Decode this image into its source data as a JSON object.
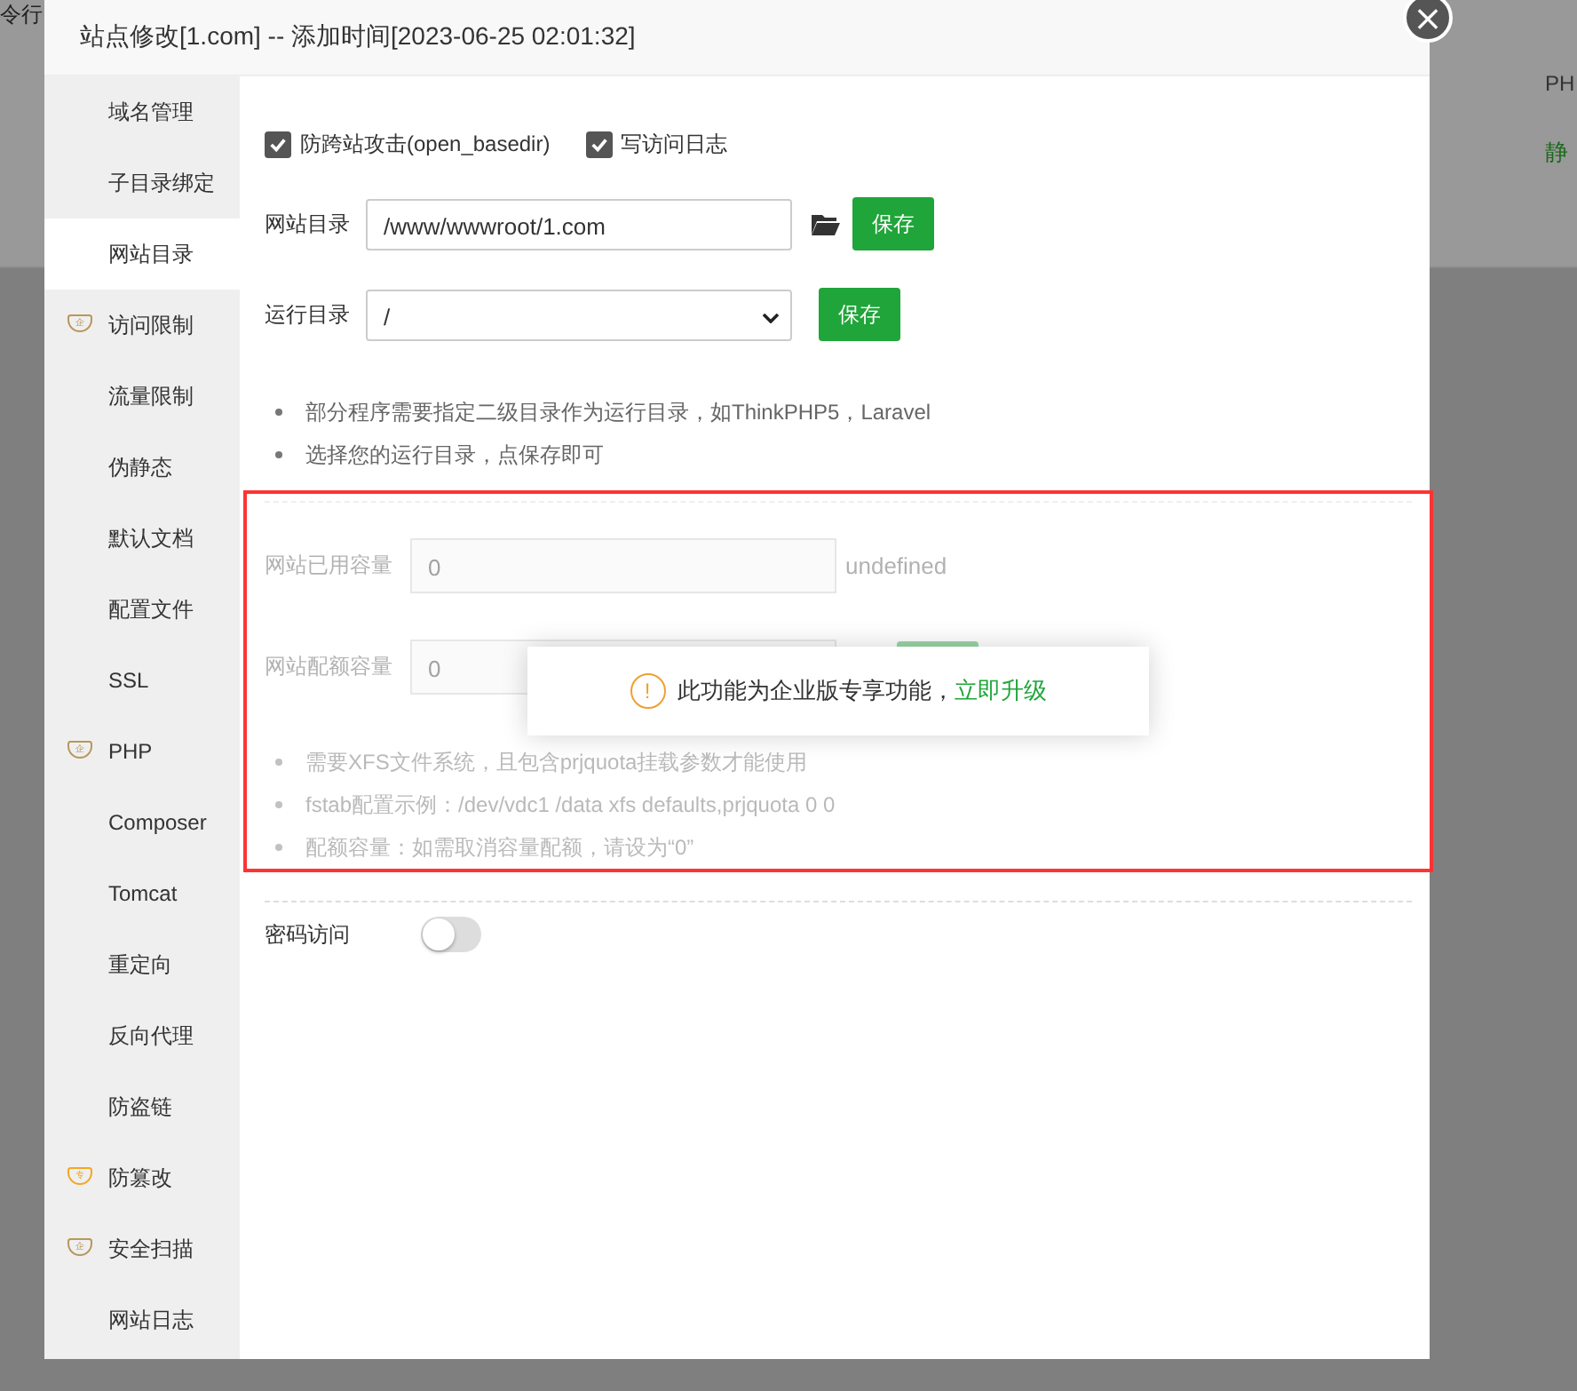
{
  "background": {
    "top_left_text": "令行",
    "column_header": "PH",
    "cell_text": "静"
  },
  "dialog": {
    "title": "站点修改[1.com] -- 添加时间[2023-06-25 02:01:32]",
    "close": "×"
  },
  "sidebar": {
    "items": [
      {
        "label": "域名管理",
        "selected": false
      },
      {
        "label": "子目录绑定",
        "selected": false
      },
      {
        "label": "网站目录",
        "selected": true
      },
      {
        "label": "访问限制",
        "selected": false,
        "badge": "企",
        "color": "#b8975c"
      },
      {
        "label": "流量限制",
        "selected": false
      },
      {
        "label": "伪静态",
        "selected": false
      },
      {
        "label": "默认文档",
        "selected": false
      },
      {
        "label": "配置文件",
        "selected": false
      },
      {
        "label": "SSL",
        "selected": false
      },
      {
        "label": "PHP",
        "selected": false,
        "badge": "企",
        "color": "#b8975c"
      },
      {
        "label": "Composer",
        "selected": false
      },
      {
        "label": "Tomcat",
        "selected": false
      },
      {
        "label": "重定向",
        "selected": false
      },
      {
        "label": "反向代理",
        "selected": false
      },
      {
        "label": "防盗链",
        "selected": false
      },
      {
        "label": "防篡改",
        "selected": false,
        "badge": "专",
        "color": "#f5a623"
      },
      {
        "label": "安全扫描",
        "selected": false,
        "badge": "企",
        "color": "#b8975c"
      },
      {
        "label": "网站日志",
        "selected": false
      }
    ]
  },
  "options": [
    {
      "label": "防跨站攻击(open_basedir)",
      "checked": true
    },
    {
      "label": "写访问日志",
      "checked": true
    }
  ],
  "site_dir": {
    "label": "网站目录",
    "value": "/www/wwwroot/1.com",
    "button": "保存"
  },
  "run_dir": {
    "label": "运行目录",
    "value": "/",
    "button": "保存"
  },
  "tips": [
    "部分程序需要指定二级目录作为运行目录，如ThinkPHP5，Laravel",
    "选择您的运行目录，点保存即可"
  ],
  "quota": {
    "disabled": true,
    "used": {
      "label": "网站已用容量",
      "value": "0",
      "unit": "undefined"
    },
    "limit": {
      "label": "网站配额容量",
      "value": "0"
    },
    "tips": [
      "需要XFS文件系统，且包含prjquota挂载参数才能使用",
      "fstab配置示例：/dev/vdc1 /data xfs defaults,prjquota 0 0",
      "配额容量：如需取消容量配额，请设为“0”"
    ]
  },
  "password_access": {
    "label": "密码访问",
    "on": false
  },
  "toast": {
    "icon": "!",
    "message": "此功能为企业版专享功能，",
    "link": "立即升级"
  }
}
